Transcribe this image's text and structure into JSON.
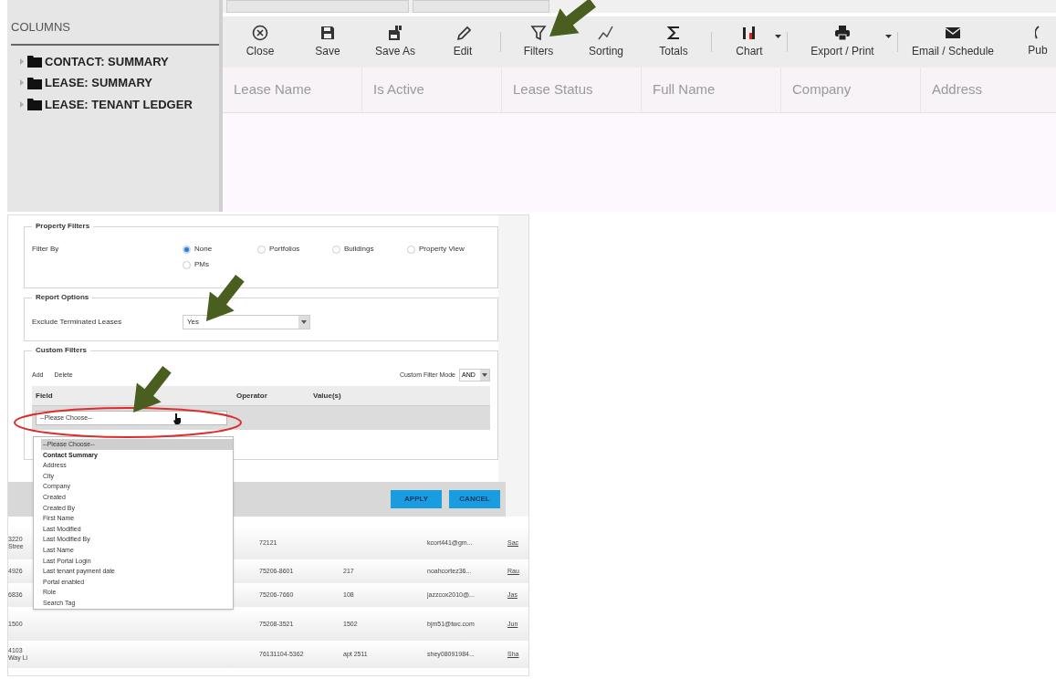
{
  "sidebar": {
    "title": "COLUMNS",
    "items": [
      {
        "label": "CONTACT: SUMMARY",
        "expanded": false
      },
      {
        "label": "LEASE: SUMMARY",
        "expanded": false
      },
      {
        "label": "LEASE: TENANT LEDGER",
        "expanded": false
      }
    ]
  },
  "toolbar": {
    "groups": [
      [
        {
          "label": "Close",
          "kind": "close",
          "has_menu": false
        },
        {
          "label": "Save",
          "kind": "save",
          "has_menu": false
        },
        {
          "label": "Save As",
          "kind": "saveas",
          "has_menu": false
        },
        {
          "label": "Edit",
          "kind": "edit",
          "has_menu": false
        }
      ],
      [
        {
          "label": "Filters",
          "kind": "filter",
          "has_menu": false
        },
        {
          "label": "Sorting",
          "kind": "sort",
          "has_menu": false
        },
        {
          "label": "Totals",
          "kind": "sum",
          "has_menu": false
        }
      ],
      [
        {
          "label": "Chart",
          "kind": "chart",
          "has_menu": true
        }
      ],
      [
        {
          "label": "Export / Print",
          "kind": "print",
          "has_menu": true
        }
      ],
      [
        {
          "label": "Email / Schedule",
          "kind": "mail",
          "has_menu": false
        },
        {
          "label": "Pub",
          "kind": "pub",
          "has_menu": false
        }
      ]
    ]
  },
  "table": {
    "columns": [
      "Lease Name",
      "Is Active",
      "Lease Status",
      "Full Name",
      "Company",
      "Address"
    ]
  },
  "filter_dialog": {
    "property_filters": {
      "title": "Property Filters",
      "label": "Filter By",
      "options": [
        {
          "label": "None",
          "selected": true
        },
        {
          "label": "Portfolios",
          "selected": false
        },
        {
          "label": "Buildings",
          "selected": false
        },
        {
          "label": "Property View",
          "selected": false
        },
        {
          "label": "PMs",
          "selected": false
        }
      ]
    },
    "report_options": {
      "title": "Report Options",
      "label": "Exclude Terminated Leases",
      "value": "Yes"
    },
    "custom_filters": {
      "title": "Custom Filters",
      "actions": [
        "Add",
        "Delete"
      ],
      "mode_label": "Custom Filter Mode",
      "mode_value": "AND",
      "columns": [
        "Field",
        "Operator",
        "Value(s)"
      ],
      "field_value": "--Please Choose--",
      "dropdown": [
        {
          "label": "--Please Choose--",
          "kind": "option",
          "selected": true
        },
        {
          "label": "Contact Summary",
          "kind": "group",
          "selected": false
        },
        {
          "label": "Address",
          "kind": "option",
          "selected": false
        },
        {
          "label": "City",
          "kind": "option",
          "selected": false
        },
        {
          "label": "Company",
          "kind": "option",
          "selected": false
        },
        {
          "label": "Created",
          "kind": "option",
          "selected": false
        },
        {
          "label": "Created By",
          "kind": "option",
          "selected": false
        },
        {
          "label": "First Name",
          "kind": "option",
          "selected": false
        },
        {
          "label": "Last Modified",
          "kind": "option",
          "selected": false
        },
        {
          "label": "Last Modified By",
          "kind": "option",
          "selected": false
        },
        {
          "label": "Last Name",
          "kind": "option",
          "selected": false
        },
        {
          "label": "Last Portal Login",
          "kind": "option",
          "selected": false
        },
        {
          "label": "Last tenant payment date",
          "kind": "option",
          "selected": false
        },
        {
          "label": "Portal enabled",
          "kind": "option",
          "selected": false
        },
        {
          "label": "Role",
          "kind": "option",
          "selected": false
        },
        {
          "label": "Search Tag",
          "kind": "option",
          "selected": false
        }
      ]
    },
    "buttons": [
      "APPLY",
      "CANCEL"
    ]
  },
  "background_rows": [
    {
      "cells": [
        "3220\nStree",
        "72121",
        "",
        "kcort441@gm...",
        "Sac"
      ]
    },
    {
      "cells": [
        "4926",
        "75206-8601",
        "217",
        "noahcortez36...",
        "Rau"
      ]
    },
    {
      "cells": [
        "6836",
        "75206-7660",
        "108",
        "jazzcox2010@...",
        "Jas"
      ]
    },
    {
      "cells": [
        "1500",
        "75208-3521",
        "1502",
        "bjm51@twc.com",
        "Jun"
      ]
    },
    {
      "cells": [
        "4103\nWay Li",
        "76131104-5362",
        "apt 2511",
        "shey08091984...",
        "Sha"
      ]
    }
  ]
}
